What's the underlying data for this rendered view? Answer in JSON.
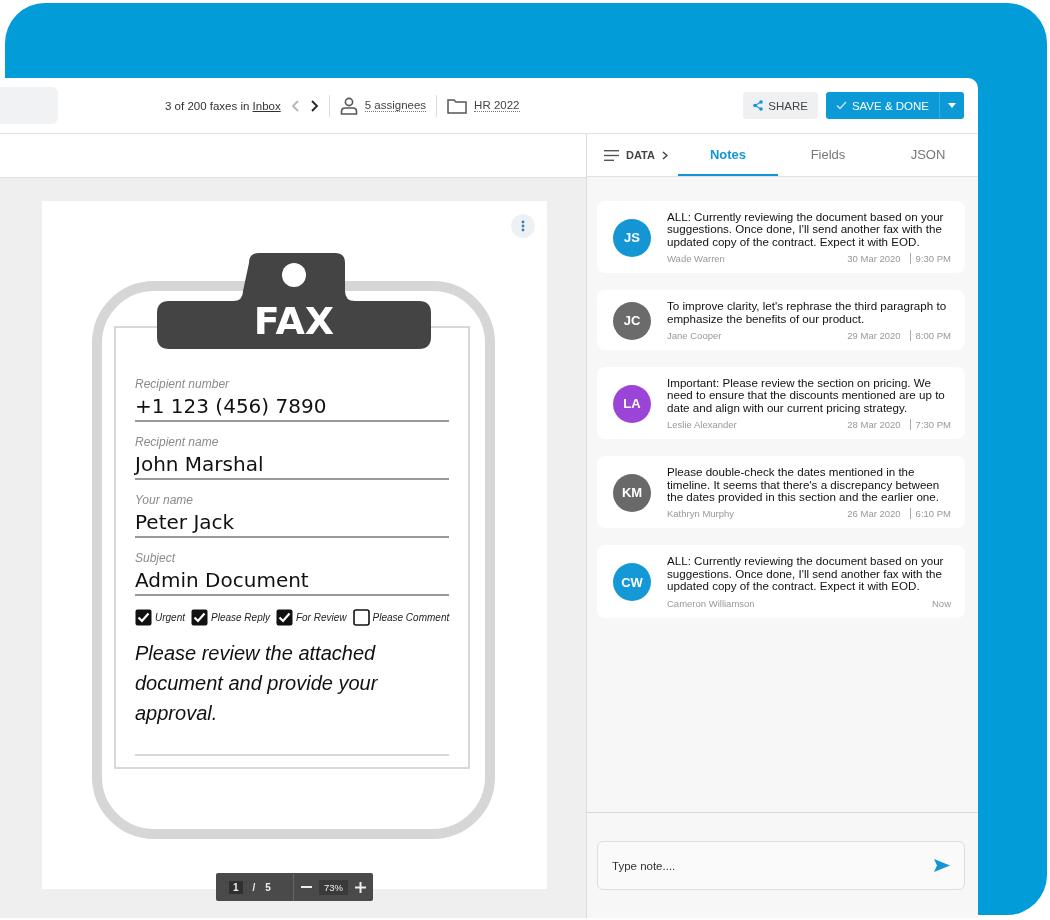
{
  "toolbar": {
    "position": "3 of 200 faxes in",
    "folder_link": "Inbox",
    "pager": [
      {
        "kind": "prev",
        "disabled": true
      },
      {
        "kind": "next",
        "disabled": false
      }
    ],
    "assignees": "5 assignees",
    "folder": "HR 2022"
  },
  "actions": [
    {
      "label": "SHARE",
      "kind": "secondary"
    },
    {
      "label": "SAVE & DONE",
      "kind": "primary"
    }
  ],
  "document": {
    "title": "FAX",
    "fields": [
      {
        "label": "Recipient number",
        "value": "+1 123 (456) 7890"
      },
      {
        "label": "Recipient name",
        "value": "John Marshal"
      },
      {
        "label": "Your name",
        "value": "Peter Jack"
      },
      {
        "label": "Subject",
        "value": "Admin Document"
      }
    ],
    "checkboxes": [
      {
        "label": "Urgent",
        "checked": true
      },
      {
        "label": "Please Reply",
        "checked": true
      },
      {
        "label": "For Review",
        "checked": true
      },
      {
        "label": "Please Comment",
        "checked": false
      }
    ],
    "message": "Please review the attached document and provide your approval.",
    "page": "1",
    "page_separator": "/",
    "pages": "5",
    "zoom": "73%"
  },
  "panel": {
    "data_label": "DATA",
    "tabs": [
      {
        "label": "Notes",
        "selected": true
      },
      {
        "label": "Fields",
        "selected": false
      },
      {
        "label": "JSON",
        "selected": false
      }
    ],
    "notes": [
      {
        "initials": "JS",
        "color": "#1496d4",
        "text": "ALL: Currently reviewing the document based on your suggestions. Once done, I'll send another fax with the updated copy of the contract. Expect it with EOD.",
        "author": "Wade Warren",
        "date": "30 Mar 2020",
        "time": "9:30 PM"
      },
      {
        "initials": "JC",
        "color": "#6b6b6b",
        "text": "To improve clarity, let's rephrase the third paragraph to emphasize the benefits of our product.",
        "author": "Jane Cooper",
        "date": "29 Mar 2020",
        "time": "8:00 PM"
      },
      {
        "initials": "LA",
        "color": "#9b45d8",
        "text": "Important: Please review the section on pricing. We need to ensure that the discounts mentioned are up to date and align with our current pricing strategy.",
        "author": "Leslie Alexander",
        "date": "28 Mar 2020",
        "time": "7:30 PM"
      },
      {
        "initials": "KM",
        "color": "#696969",
        "text": "Please double-check the dates mentioned in the timeline. It seems that there's a discrepancy between the dates provided in this section and the earlier one.",
        "author": "Kathryn Murphy",
        "date": "26 Mar 2020",
        "time": "6:10 PM"
      },
      {
        "initials": "CW",
        "color": "#1499d6",
        "text": "ALL: Currently reviewing the document based on your suggestions. Once done, I'll send another fax with the updated copy of the contract. Expect it with EOD.",
        "author": "Cameron Williamson",
        "time": "Now"
      }
    ],
    "composer": {
      "placeholder": "Type note...."
    }
  }
}
